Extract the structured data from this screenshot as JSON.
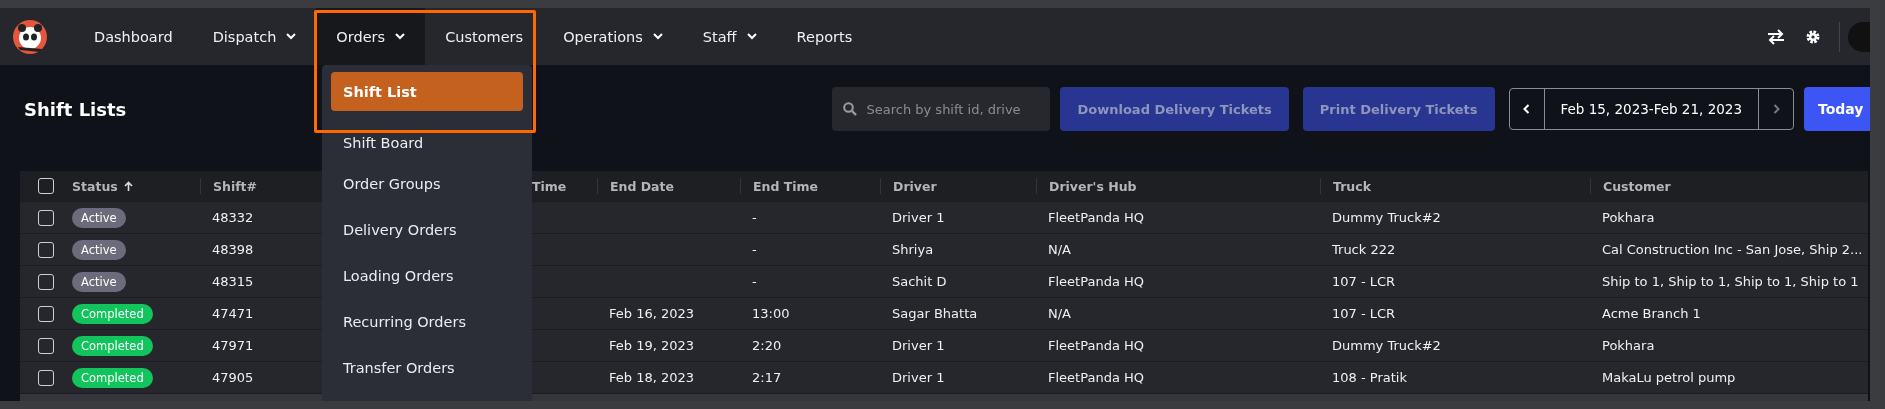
{
  "nav": {
    "items": [
      {
        "label": "Dashboard",
        "has_menu": false,
        "selected": false
      },
      {
        "label": "Dispatch",
        "has_menu": true,
        "selected": false
      },
      {
        "label": "Orders",
        "has_menu": true,
        "selected": true
      },
      {
        "label": "Customers",
        "has_menu": false,
        "selected": false
      },
      {
        "label": "Operations",
        "has_menu": true,
        "selected": false
      },
      {
        "label": "Staff",
        "has_menu": true,
        "selected": false
      },
      {
        "label": "Reports",
        "has_menu": false,
        "selected": false
      }
    ]
  },
  "orders_menu": {
    "items": [
      {
        "label": "Shift List",
        "selected": true
      },
      {
        "label": "Shift Board",
        "selected": false
      },
      {
        "label": "Order Groups",
        "selected": false
      },
      {
        "label": "Delivery Orders",
        "selected": false
      },
      {
        "label": "Loading Orders",
        "selected": false
      },
      {
        "label": "Recurring Orders",
        "selected": false
      },
      {
        "label": "Transfer Orders",
        "selected": false
      }
    ]
  },
  "header": {
    "title": "Shift Lists",
    "search": {
      "placeholder": "Search by shift id, drive"
    },
    "buttons": [
      "Download Delivery Tickets",
      "Print Delivery Tickets"
    ],
    "date_range": "Feb 15, 2023-Feb 21, 2023",
    "today_button": "Today"
  },
  "table": {
    "select_all_checked": false,
    "columns": [
      {
        "label": "Status",
        "sorted": true
      },
      {
        "label": "Shift#",
        "sorted": false
      },
      {
        "label": "Time",
        "sorted": false
      },
      {
        "label": "End Date",
        "sorted": false
      },
      {
        "label": "End Time",
        "sorted": false
      },
      {
        "label": "Driver",
        "sorted": false
      },
      {
        "label": "Driver's Hub",
        "sorted": false
      },
      {
        "label": "Truck",
        "sorted": false
      },
      {
        "label": "Customer",
        "sorted": false
      }
    ],
    "rows": [
      {
        "checked": false,
        "status": "Active",
        "color": "#6c6b7b",
        "shift": "48332",
        "end_time": "-",
        "driver": "Driver 1",
        "hub": "FleetPanda HQ",
        "truck": "Dummy Truck#2",
        "customer": "Pokhara"
      },
      {
        "checked": false,
        "status": "Active",
        "color": "#6c6b7b",
        "shift": "48398",
        "end_time": "-",
        "driver": "Shriya",
        "hub": "N/A",
        "truck": "Truck 222",
        "customer": "Cal Construction Inc - San Jose, Ship 2..."
      },
      {
        "checked": false,
        "status": "Active",
        "color": "#6c6b7b",
        "shift": "48315",
        "end_time": "-",
        "driver": "Sachit D",
        "hub": "FleetPanda HQ",
        "truck": "107 - LCR",
        "customer": "Ship to 1, Ship to 1, Ship to 1, Ship to 1"
      },
      {
        "checked": false,
        "status": "Completed",
        "color": "#12c45c",
        "shift": "47471",
        "end_date": "Feb 16, 2023",
        "end_time": "13:00",
        "driver": "Sagar Bhatta",
        "hub": "N/A",
        "truck": "107 - LCR",
        "customer": "Acme Branch 1"
      },
      {
        "checked": false,
        "status": "Completed",
        "color": "#12c45c",
        "shift": "47971",
        "end_date": "Feb 19, 2023",
        "end_time": "2:20",
        "driver": "Driver 1",
        "hub": "FleetPanda HQ",
        "truck": "Dummy Truck#2",
        "customer": "Pokhara"
      },
      {
        "checked": false,
        "status": "Completed",
        "color": "#12c45c",
        "shift": "47905",
        "end_date": "Feb 18, 2023",
        "end_time": "2:17",
        "driver": "Driver 1",
        "hub": "FleetPanda HQ",
        "truck": "108 - Pratik",
        "customer": "MakaLu petrol pump"
      }
    ]
  }
}
